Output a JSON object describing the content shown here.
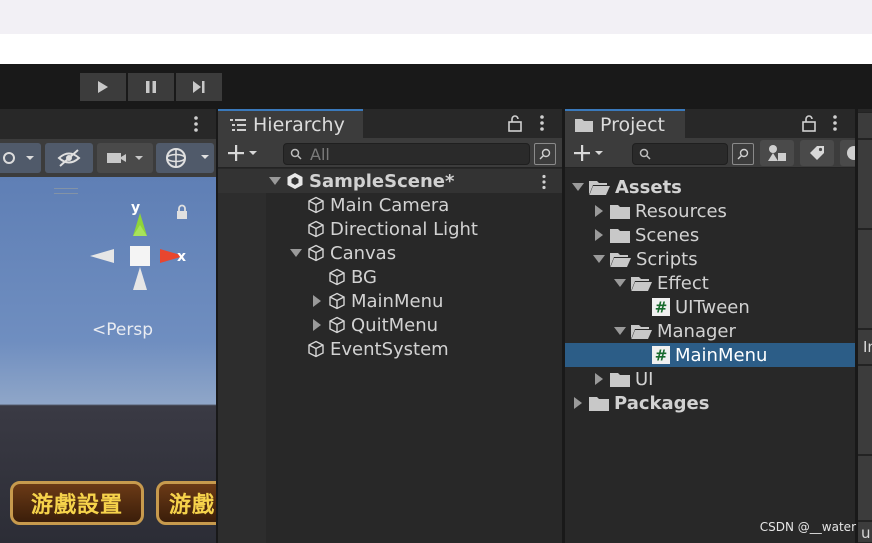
{
  "toolbar": {
    "play_icon": "play-icon",
    "pause_icon": "pause-icon",
    "step_icon": "step-icon"
  },
  "scene": {
    "gizmo": {
      "y_label": "y",
      "x_label": "x"
    },
    "persp_label": "Persp",
    "game_buttons": [
      "游戲設置",
      "游戲"
    ]
  },
  "hierarchy": {
    "tab_label": "Hierarchy",
    "search_placeholder": "All",
    "items": [
      {
        "label": "SampleScene*",
        "depth": 0,
        "arrow": "down",
        "icon": "unity-icon",
        "bold": true
      },
      {
        "label": "Main Camera",
        "depth": 1,
        "arrow": "none",
        "icon": "gameobject-icon"
      },
      {
        "label": "Directional Light",
        "depth": 1,
        "arrow": "none",
        "icon": "gameobject-icon"
      },
      {
        "label": "Canvas",
        "depth": 1,
        "arrow": "down",
        "icon": "gameobject-icon"
      },
      {
        "label": "BG",
        "depth": 2,
        "arrow": "none",
        "icon": "gameobject-icon"
      },
      {
        "label": "MainMenu",
        "depth": 2,
        "arrow": "right",
        "icon": "gameobject-icon"
      },
      {
        "label": "QuitMenu",
        "depth": 2,
        "arrow": "right",
        "icon": "gameobject-icon"
      },
      {
        "label": "EventSystem",
        "depth": 1,
        "arrow": "none",
        "icon": "gameobject-icon"
      }
    ]
  },
  "project": {
    "tab_label": "Project",
    "items": [
      {
        "label": "Assets",
        "depth": 0,
        "arrow": "down",
        "icon": "folder-open-icon",
        "bold": true
      },
      {
        "label": "Resources",
        "depth": 1,
        "arrow": "right",
        "icon": "folder-icon"
      },
      {
        "label": "Scenes",
        "depth": 1,
        "arrow": "right",
        "icon": "folder-icon"
      },
      {
        "label": "Scripts",
        "depth": 1,
        "arrow": "down",
        "icon": "folder-open-icon"
      },
      {
        "label": "Effect",
        "depth": 2,
        "arrow": "down",
        "icon": "folder-open-icon"
      },
      {
        "label": "UITween",
        "depth": 3,
        "arrow": "none",
        "icon": "script-icon"
      },
      {
        "label": "Manager",
        "depth": 2,
        "arrow": "down",
        "icon": "folder-open-icon"
      },
      {
        "label": "MainMenu",
        "depth": 3,
        "arrow": "none",
        "icon": "script-icon",
        "selected": true
      },
      {
        "label": "UI",
        "depth": 1,
        "arrow": "right",
        "icon": "folder-icon"
      },
      {
        "label": "Packages",
        "depth": 0,
        "arrow": "right",
        "icon": "folder-icon",
        "bold": true
      }
    ]
  },
  "inspector": {
    "labels": [
      "In",
      "u"
    ]
  },
  "watermark": "CSDN @__water"
}
